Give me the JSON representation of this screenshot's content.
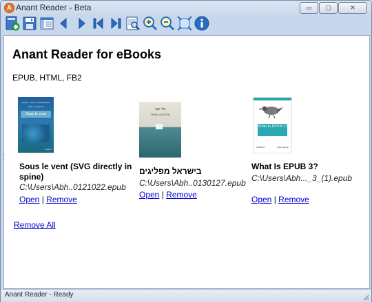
{
  "window": {
    "title": "Anant Reader - Beta",
    "app_icon_letter": "A",
    "buttons": {
      "minimize": "▭",
      "maximize": "▢",
      "close": "✕"
    }
  },
  "toolbar": {
    "icons": [
      "add-book-icon",
      "save-icon",
      "library-icon",
      "previous-icon",
      "next-icon",
      "first-page-icon",
      "last-page-icon",
      "zoom-page-icon",
      "zoom-in-icon",
      "zoom-out-icon",
      "fit-screen-icon",
      "info-icon"
    ]
  },
  "main": {
    "title": "Anant Reader for eBooks",
    "formats": "EPUB, HTML, FB2",
    "books": [
      {
        "title": "Sous le vent (SVG directly in spine)",
        "path": "C:\\Users\\Abh..0121022.epub",
        "open_label": "Open",
        "remove_label": "Remove",
        "cover": {
          "line1": "Fabien - Marc-Adrien Bonjut",
          "line2": "Jean L. Aubouin",
          "text": "Sous le vent",
          "publisher": "Éditeur"
        }
      },
      {
        "title": "בישראל מפליגים",
        "path": "C:\\Users\\Abh..0130127.epub",
        "open_label": "Open",
        "remove_label": "Remove",
        "cover": {
          "line1": "אלי ענך",
          "line2": "מפליגים בישראל"
        }
      },
      {
        "title": "What Is EPUB 3?",
        "path": "C:\\Users\\Abh..._3_(1).epub",
        "open_label": "Open",
        "remove_label": "Remove",
        "cover": {
          "text": "What Is EPUB 3?",
          "publisher": "O'REILLY",
          "author": "Matt Garrish"
        }
      }
    ],
    "remove_all_label": "Remove All"
  },
  "status": {
    "text": "Anant Reader - Ready"
  },
  "colors": {
    "link": "#0000cc",
    "toolbar_blue": "#2a6cc4"
  }
}
